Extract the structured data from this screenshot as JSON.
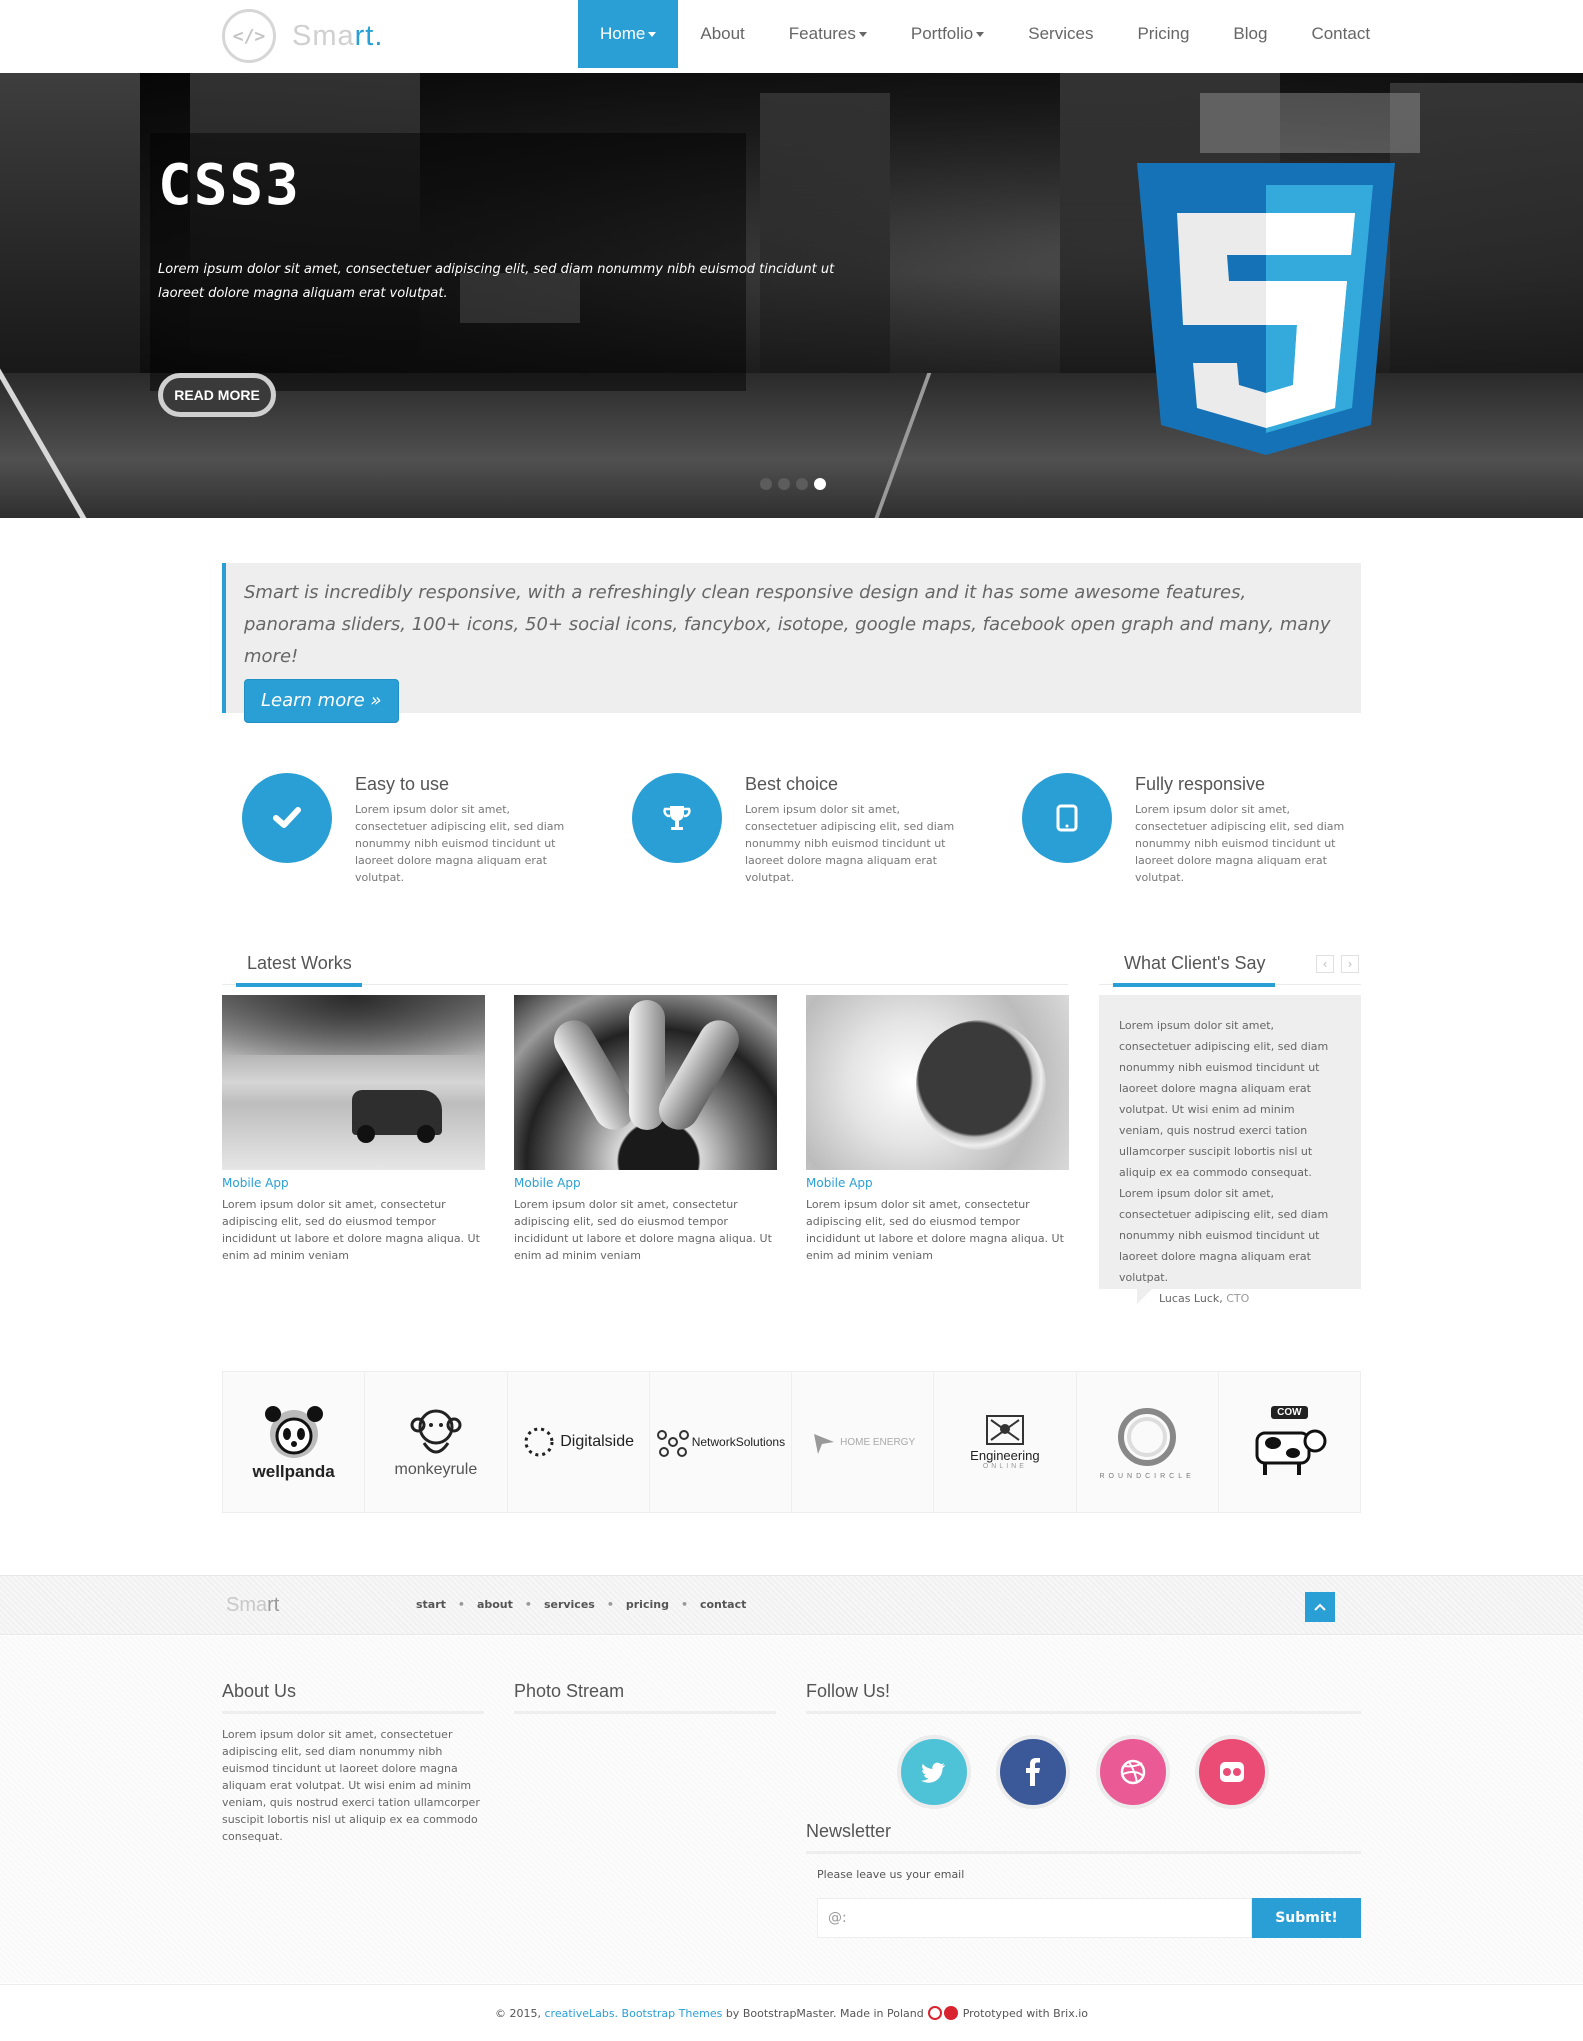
{
  "brand": {
    "prefix": "Sma",
    "accent": "rt",
    "suffix": ".",
    "badge": "</>"
  },
  "nav": [
    {
      "label": "Home",
      "caret": true,
      "active": true
    },
    {
      "label": "About",
      "caret": false
    },
    {
      "label": "Features",
      "caret": true
    },
    {
      "label": "Portfolio",
      "caret": true
    },
    {
      "label": "Services",
      "caret": false
    },
    {
      "label": "Pricing",
      "caret": false
    },
    {
      "label": "Blog",
      "caret": false
    },
    {
      "label": "Contact",
      "caret": false
    }
  ],
  "hero": {
    "title": "CSS3",
    "text": "Lorem ipsum dolor sit amet, consectetuer adipiscing elit, sed diam nonummy nibh euismod tincidunt ut laoreet dolore magna aliquam erat volutpat.",
    "button": "READ MORE",
    "slides": 4,
    "active_slide": 4,
    "badge_icon": "css3-shield-icon"
  },
  "intro": {
    "text": "Smart is incredibly responsive, with a refreshingly clean responsive design and it has some awesome features, panorama sliders, 100+ icons, 50+ social icons, fancybox, isotope, google maps, facebook open graph and many, many more!",
    "button": "Learn more »"
  },
  "features": [
    {
      "icon": "check-icon",
      "title": "Easy to use",
      "desc": "Lorem ipsum dolor sit amet, consectetuer adipiscing elit, sed diam nonummy nibh euismod tincidunt ut laoreet dolore magna aliquam erat volutpat."
    },
    {
      "icon": "trophy-icon",
      "title": "Best choice",
      "desc": "Lorem ipsum dolor sit amet, consectetuer adipiscing elit, sed diam nonummy nibh euismod tincidunt ut laoreet dolore magna aliquam erat volutpat."
    },
    {
      "icon": "tablet-icon",
      "title": "Fully responsive",
      "desc": "Lorem ipsum dolor sit amet, consectetuer adipiscing elit, sed diam nonummy nibh euismod tincidunt ut laoreet dolore magna aliquam erat volutpat."
    }
  ],
  "works": {
    "title": "Latest Works",
    "items": [
      {
        "category": "Mobile App",
        "desc": "Lorem ipsum dolor sit amet, consectetur adipiscing elit, sed do eiusmod tempor incididunt ut labore et dolore magna aliqua. Ut enim ad minim veniam"
      },
      {
        "category": "Mobile App",
        "desc": "Lorem ipsum dolor sit amet, consectetur adipiscing elit, sed do eiusmod tempor incididunt ut labore et dolore magna aliqua. Ut enim ad minim veniam"
      },
      {
        "category": "Mobile App",
        "desc": "Lorem ipsum dolor sit amet, consectetur adipiscing elit, sed do eiusmod tempor incididunt ut labore et dolore magna aliqua. Ut enim ad minim veniam"
      }
    ]
  },
  "testimonials": {
    "title": "What Client's Say",
    "text": "Lorem ipsum dolor sit amet, consectetuer adipiscing elit, sed diam nonummy nibh euismod tincidunt ut laoreet dolore magna aliquam erat volutpat. Ut wisi enim ad minim veniam, quis nostrud exerci tation ullamcorper suscipit lobortis nisl ut aliquip ex ea commodo consequat. Lorem ipsum dolor sit amet, consectetuer adipiscing elit, sed diam nonummy nibh euismod tincidunt ut laoreet dolore magna aliquam erat volutpat.",
    "author": "Lucas Luck,",
    "role": "CTO",
    "prev": "‹",
    "next": "›"
  },
  "clients": [
    {
      "name": "wellpanda"
    },
    {
      "name": "monkeyrule"
    },
    {
      "name": "Digitalside"
    },
    {
      "name": "NetworkSolutions"
    },
    {
      "name": "HOME ENERGY"
    },
    {
      "name": "Engineering",
      "sub": "ONLINE"
    },
    {
      "name": "ROUNDCIRCLE"
    },
    {
      "name": "COW"
    }
  ],
  "footbar": {
    "logo_prefix": "Sma",
    "logo_accent": "rt",
    "links": [
      "start",
      "about",
      "services",
      "pricing",
      "contact"
    ]
  },
  "footer": {
    "about_title": "About Us",
    "about_text": "Lorem ipsum dolor sit amet, consectetuer adipiscing elit, sed diam nonummy nibh euismod tincidunt ut laoreet dolore magna aliquam erat volutpat. Ut wisi enim ad minim veniam, quis nostrud exerci tation ullamcorper suscipit lobortis nisl ut aliquip ex ea commodo consequat.",
    "photo_title": "Photo Stream",
    "follow_title": "Follow Us!",
    "social": [
      {
        "icon": "twitter-icon",
        "color": "#4ec2d6"
      },
      {
        "icon": "facebook-icon",
        "color": "#3b5998"
      },
      {
        "icon": "dribbble-icon",
        "color": "#ea5a95"
      },
      {
        "icon": "flickr-icon",
        "color": "#ea4c76"
      }
    ],
    "newsletter_title": "Newsletter",
    "newsletter_label": "Please leave us your email",
    "newsletter_placeholder": "@:",
    "newsletter_button": "Submit!"
  },
  "copyright": {
    "prefix": "© 2015,",
    "link1": "creativeLabs.",
    "link2": "Bootstrap Themes",
    "middle": "by BootstrapMaster. Made in Poland",
    "suffix": "Prototyped with Brix.io"
  },
  "colors": {
    "accent": "#2a9fd6",
    "css3_blue": "#1572b6",
    "css3_light": "#33a9dc"
  }
}
